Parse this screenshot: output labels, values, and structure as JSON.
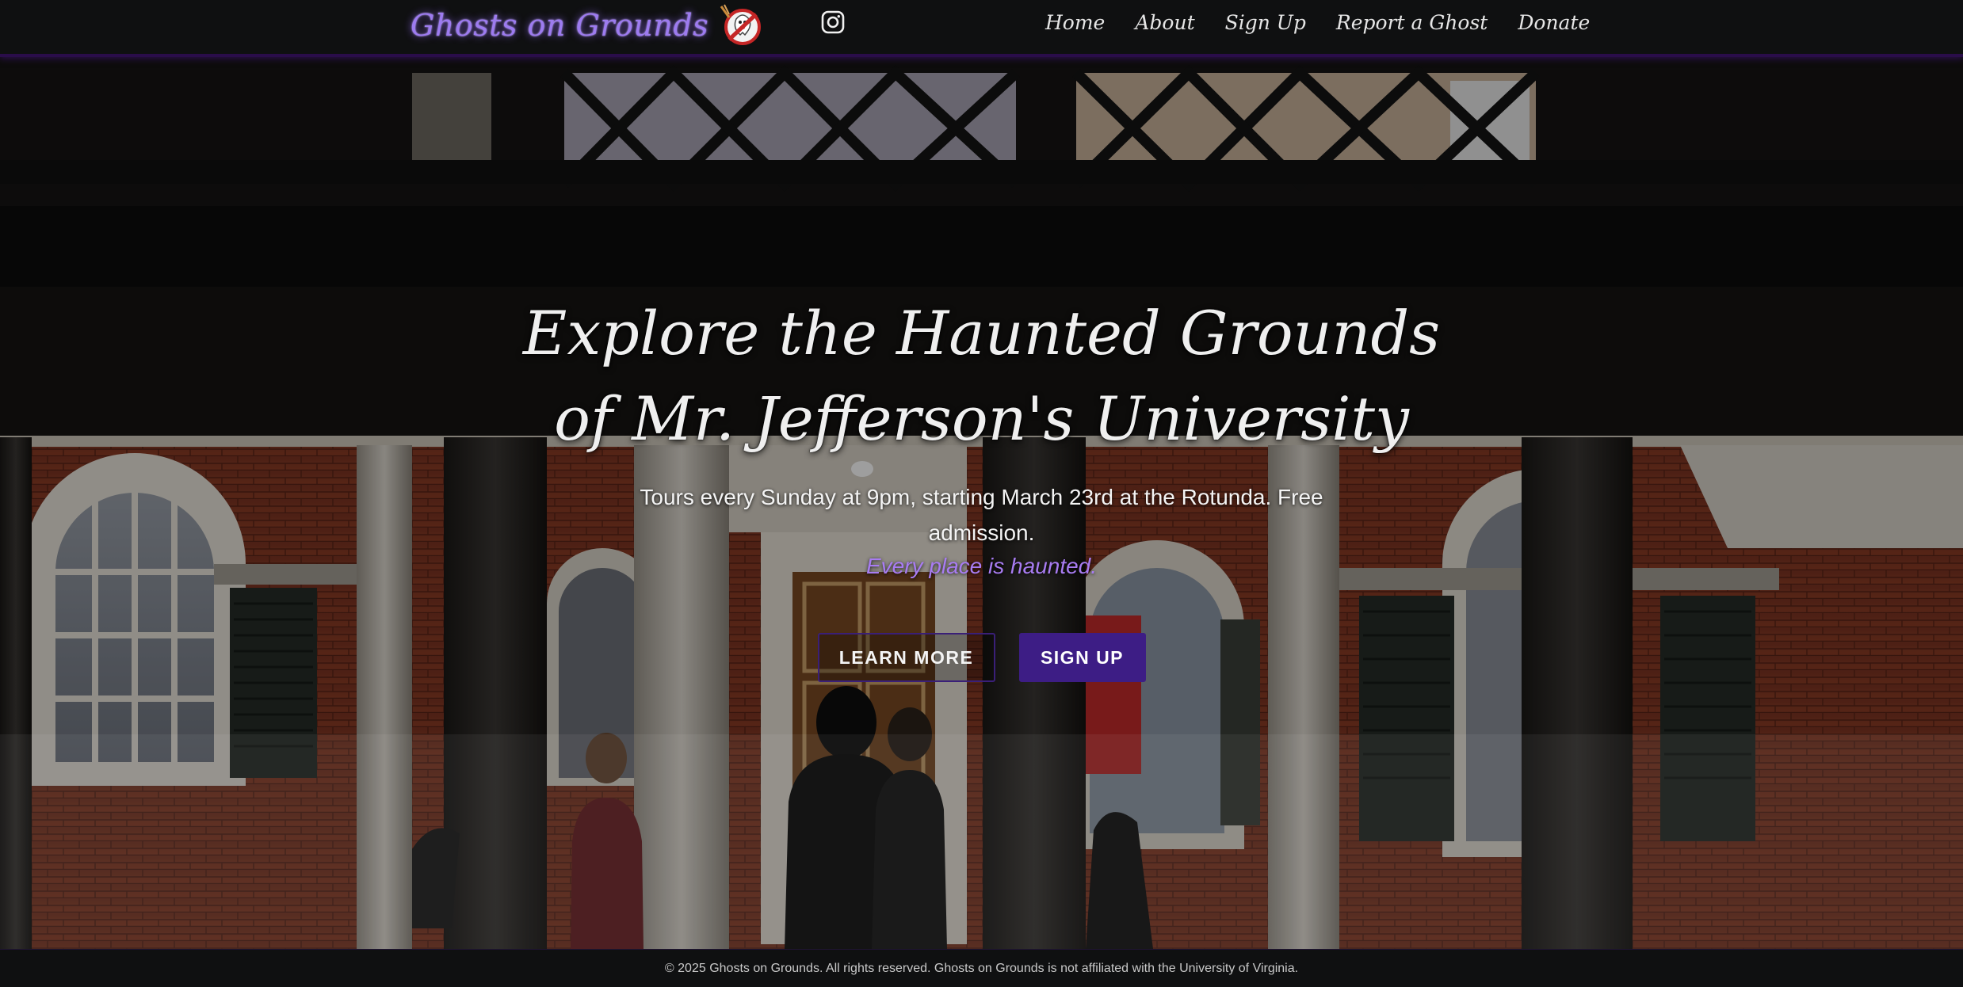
{
  "brand": {
    "name": "Ghosts on Grounds",
    "logo_icon": "ghostbusters-style-ghost-logo-icon"
  },
  "social": {
    "instagram_icon": "instagram-icon"
  },
  "nav": {
    "items": [
      {
        "label": "Home"
      },
      {
        "label": "About"
      },
      {
        "label": "Sign Up"
      },
      {
        "label": "Report a Ghost"
      },
      {
        "label": "Donate"
      }
    ]
  },
  "hero": {
    "title": "Explore the Haunted Grounds of Mr. Jefferson's University",
    "subtitle": "Tours every Sunday at 9pm, starting March 23rd at the Rotunda. Free admission.",
    "tagline": "Every place is haunted.",
    "buttons": {
      "learn_more": "Learn More",
      "sign_up": "Sign Up"
    }
  },
  "footer": {
    "text": "© 2025 Ghosts on Grounds. All rights reserved. Ghosts on Grounds is not affiliated with the University of Virginia."
  },
  "colors": {
    "accent_purple": "#3d1d85",
    "brand_glow": "#9d7bf0",
    "tagline": "#a87cf2",
    "nav_bg": "#0f1011"
  }
}
